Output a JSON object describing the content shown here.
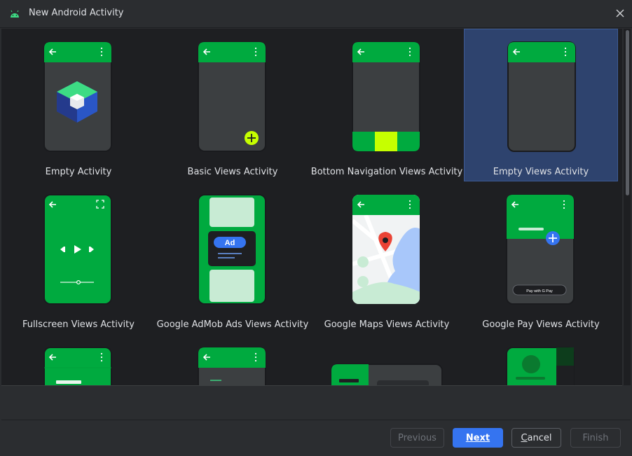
{
  "window": {
    "title": "New Android Activity",
    "icon": "android-icon",
    "close_icon": "close-icon"
  },
  "templates": [
    {
      "label": "Empty Activity",
      "selected": false
    },
    {
      "label": "Basic Views Activity",
      "selected": false
    },
    {
      "label": "Bottom Navigation Views Activity",
      "selected": false
    },
    {
      "label": "Empty Views Activity",
      "selected": true
    },
    {
      "label": "Fullscreen Views Activity",
      "selected": false
    },
    {
      "label": "Google AdMob Ads Views Activity",
      "selected": false
    },
    {
      "label": "Google Maps Views Activity",
      "selected": false
    },
    {
      "label": "Google Pay Views Activity",
      "selected": false
    }
  ],
  "previews": {
    "admob_badge": "Ad",
    "gpay_button": "Pay with G Pay"
  },
  "buttons": {
    "previous": "Previous",
    "next": "Next",
    "cancel_pre": "",
    "cancel_underline": "C",
    "cancel_rest": "ancel",
    "finish": "Finish"
  },
  "colors": {
    "accent_green": "#00aa3f",
    "selection": "#2e436e",
    "primary_button": "#3574f0",
    "background": "#2b2d30",
    "gallery_background": "#1e1f22"
  }
}
